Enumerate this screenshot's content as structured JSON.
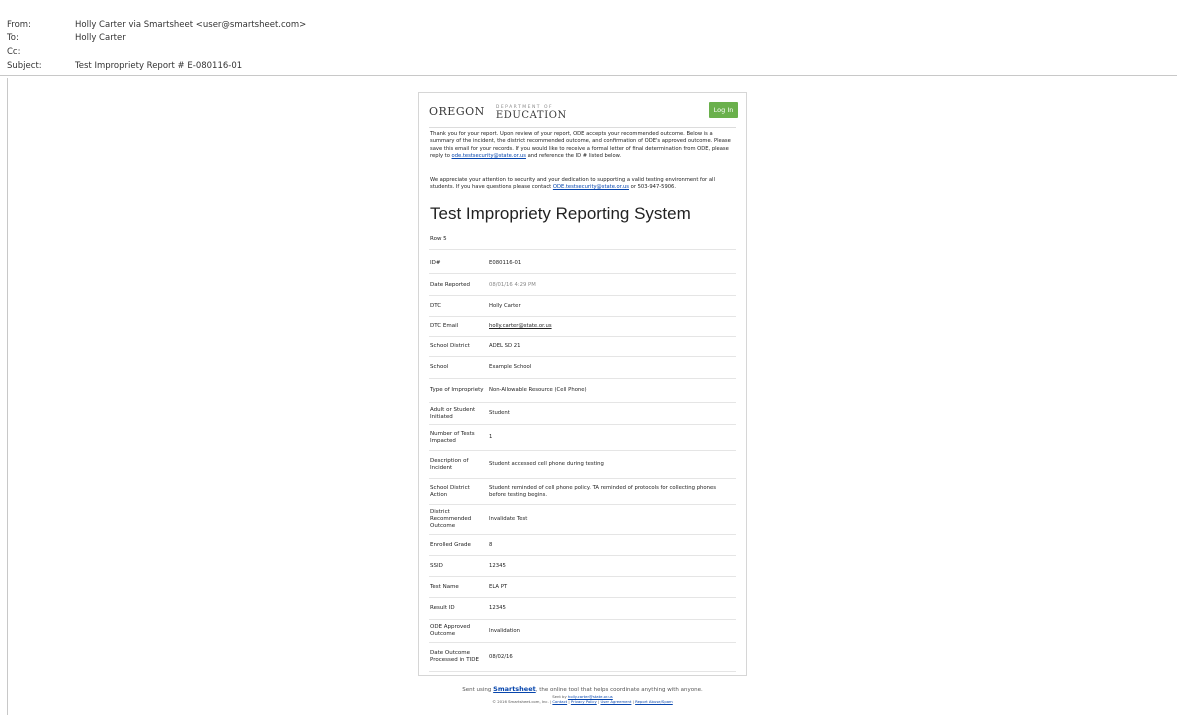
{
  "header": {
    "from_label": "From:",
    "from_value": "Holly Carter via Smartsheet <user@smartsheet.com>",
    "to_label": "To:",
    "to_value": "Holly Carter",
    "cc_label": "Cc:",
    "cc_value": "",
    "subject_label": "Subject:",
    "subject_value": "Test Impropriety Report # E-080116-01"
  },
  "email": {
    "logo_oregon": "OREGON",
    "logo_dept": "DEPARTMENT OF",
    "logo_education": "EDUCATION",
    "login_button": "Log In",
    "para1_a": "Thank you for your report. Upon review of your report, ODE accepts your recommended outcome. Below is a summary of the incident, the district recommended outcome, and confirmation of ODE's approved outcome. Please save this email for your records. If you would like to receive a formal letter of final determination from ODE, please reply to ",
    "para1_link": "ode.testsecurity@state.or.us",
    "para1_b": " and reference the ID # listed below.",
    "para2_a": "We appreciate your attention to security and your dedication to supporting a valid testing environment for all students. If you have questions please contact ",
    "para2_link": "ODE.testsecurity@state.or.us",
    "para2_b": " or 503-947-5906.",
    "title": "Test Impropriety Reporting System",
    "rows_label": "Row 5",
    "rows": [
      {
        "label": "ID#",
        "value": "E080116-01"
      },
      {
        "label": "Date Reported",
        "value": "08/01/16 4:29 PM"
      },
      {
        "label": "DTC",
        "value": "Holly Carter"
      },
      {
        "label": "DTC Email",
        "value": "holly.carter@state.or.us"
      },
      {
        "label": "School District",
        "value": "ADEL SD 21"
      },
      {
        "label": "School",
        "value": "Example School"
      },
      {
        "label": "Type of Impropriety",
        "value": "Non-Allowable Resource (Cell Phone)"
      },
      {
        "label": "Adult or Student Initiated",
        "value": "Student"
      },
      {
        "label": "Number of Tests Impacted",
        "value": "1"
      },
      {
        "label": "Description of Incident",
        "value": "Student accessed cell phone during testing"
      },
      {
        "label": "School District Action",
        "value": "Student reminded of cell phone policy. TA reminded of protocols for collecting phones before testing begins."
      },
      {
        "label": "District Recommended Outcome",
        "value": "Invalidate Test"
      },
      {
        "label": "Enrolled Grade",
        "value": "8"
      },
      {
        "label": "SSID",
        "value": "12345"
      },
      {
        "label": "Test Name",
        "value": "ELA PT"
      },
      {
        "label": "Result ID",
        "value": "12345"
      },
      {
        "label": "ODE Approved Outcome",
        "value": "Invalidation"
      },
      {
        "label": "Date Outcome Processed in TIDE",
        "value": "08/02/16"
      }
    ],
    "footer_a": "Sent using ",
    "footer_brand": "Smartsheet",
    "footer_b": ", the online tool that helps coordinate anything with anyone.",
    "footer_sent_by_a": "Sent by ",
    "footer_sent_by_email": "holly.carter@state.or.us",
    "footer_copyright": "© 2016 Smartsheet.com, Inc. | ",
    "footer_contact": "Contact",
    "footer_privacy": "Privacy Policy",
    "footer_user_agreement": "User Agreement",
    "footer_report_abuse": "Report Abuse/Spam",
    "sep": " | "
  }
}
